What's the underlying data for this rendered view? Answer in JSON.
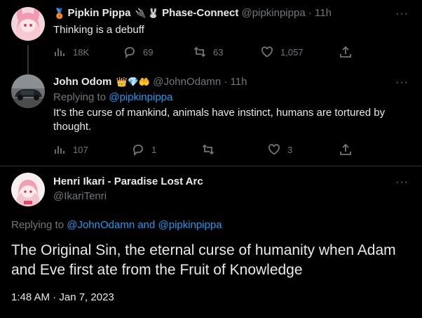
{
  "tweet1": {
    "name": "Pipkin Pippa",
    "emojis": "🥉 🔌 🐰",
    "affiliation": "Phase-Connect",
    "handle": "@pipkinpippa",
    "time": "· 11h",
    "text": "Thinking is a debuff",
    "views": "18K",
    "replies": "69",
    "retweets": "63",
    "likes": "1,057",
    "more": "···"
  },
  "tweet2": {
    "name": "John Odom",
    "emojis": "👑💎🤲",
    "handle": "@JohnOdamn",
    "time": "· 11h",
    "replying_prefix": "Replying to ",
    "replying_to": "@pipkinpippa",
    "text": "It's the curse of mankind, animals have instinct, humans are tortured by thought.",
    "views": "107",
    "replies": "1",
    "retweets": "",
    "likes": "3",
    "more": "···"
  },
  "tweet3": {
    "name": "Henri Ikari - Paradise Lost Arc",
    "handle": "@IkariTenri",
    "replying_prefix": "Replying to ",
    "replying_to": "@JohnOdamn and @pipkinpippa",
    "text": "The Original Sin, the eternal curse of humanity when Adam and Eve first ate from the Fruit of Knowledge",
    "timestamp": "1:48 AM · Jan 7, 2023",
    "more": "···"
  },
  "colors": {
    "background": "#000000",
    "text": "#e7e9ea",
    "muted": "#71767b",
    "accent": "#1d9bf0",
    "divider": "#2f3336"
  }
}
